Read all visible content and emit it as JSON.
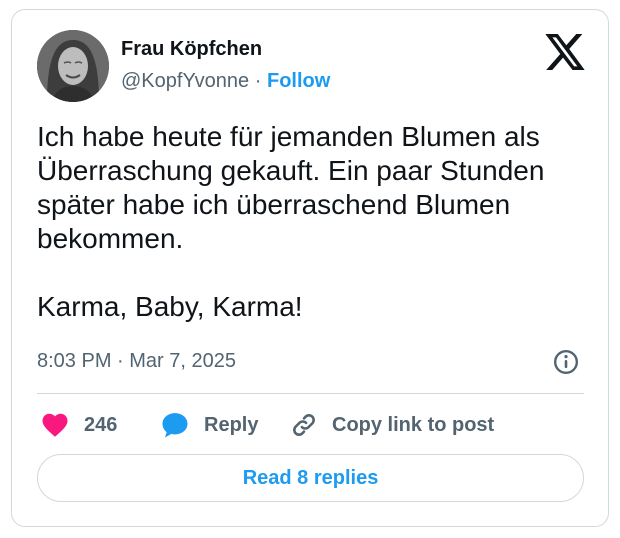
{
  "author": {
    "display_name": "Frau Köpfchen",
    "handle": "@KopfYvonne",
    "separator": "·",
    "follow_label": "Follow"
  },
  "tweet": {
    "paragraphs": [
      "Ich habe heute für jemanden Blumen als Überraschung gekauft. Ein paar Stunden später habe ich überraschend Blumen bekommen.",
      "Karma, Baby, Karma!"
    ],
    "timestamp": "8:03 PM · Mar 7, 2025"
  },
  "actions": {
    "like_count": "246",
    "reply_label": "Reply",
    "copy_link_label": "Copy link to post"
  },
  "read_replies_label": "Read 8 replies",
  "colors": {
    "accent": "#1d9bf0",
    "like": "#f91880",
    "text": "#0f1419",
    "secondary_text": "#536471",
    "border": "#cfd9de"
  },
  "icons": {
    "platform_logo": "x-logo-icon",
    "info": "info-icon",
    "like": "heart-icon",
    "reply": "speech-bubble-icon",
    "copy_link": "link-icon"
  }
}
